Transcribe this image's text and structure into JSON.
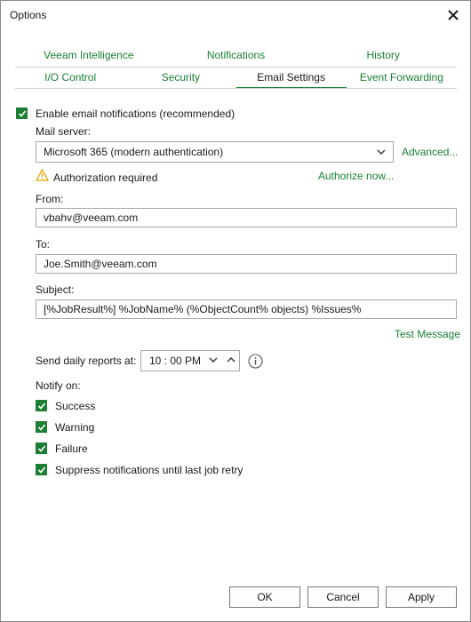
{
  "window": {
    "title": "Options"
  },
  "tabs": {
    "row1": [
      "Veeam Intelligence",
      "Notifications",
      "History"
    ],
    "row2": [
      "I/O Control",
      "Security",
      "Email Settings",
      "Event Forwarding"
    ],
    "active": "Email Settings"
  },
  "email": {
    "enable_label": "Enable email notifications (recommended)",
    "enable_checked": true,
    "mail_server_label": "Mail server:",
    "mail_server_value": "Microsoft 365 (modern authentication)",
    "advanced_link": "Advanced...",
    "auth_status": "Authorization required",
    "authorize_link": "Authorize now...",
    "from_label": "From:",
    "from_value": "vbahv@veeam.com",
    "to_label": "To:",
    "to_value": "Joe.Smith@veeam.com",
    "subject_label": "Subject:",
    "subject_value": "[%JobResult%] %JobName% (%ObjectCount% objects) %Issues%",
    "test_link": "Test Message",
    "daily_label": "Send daily reports at:",
    "daily_time": "10 : 00 PM",
    "notify_label": "Notify on:",
    "notify_options": [
      {
        "label": "Success",
        "checked": true
      },
      {
        "label": "Warning",
        "checked": true
      },
      {
        "label": "Failure",
        "checked": true
      },
      {
        "label": "Suppress notifications until last job retry",
        "checked": true
      }
    ]
  },
  "buttons": {
    "ok": "OK",
    "cancel": "Cancel",
    "apply": "Apply"
  },
  "colors": {
    "accent": "#1a7f37",
    "checkbox": "#1e7e34",
    "warning": "#e8a400"
  }
}
